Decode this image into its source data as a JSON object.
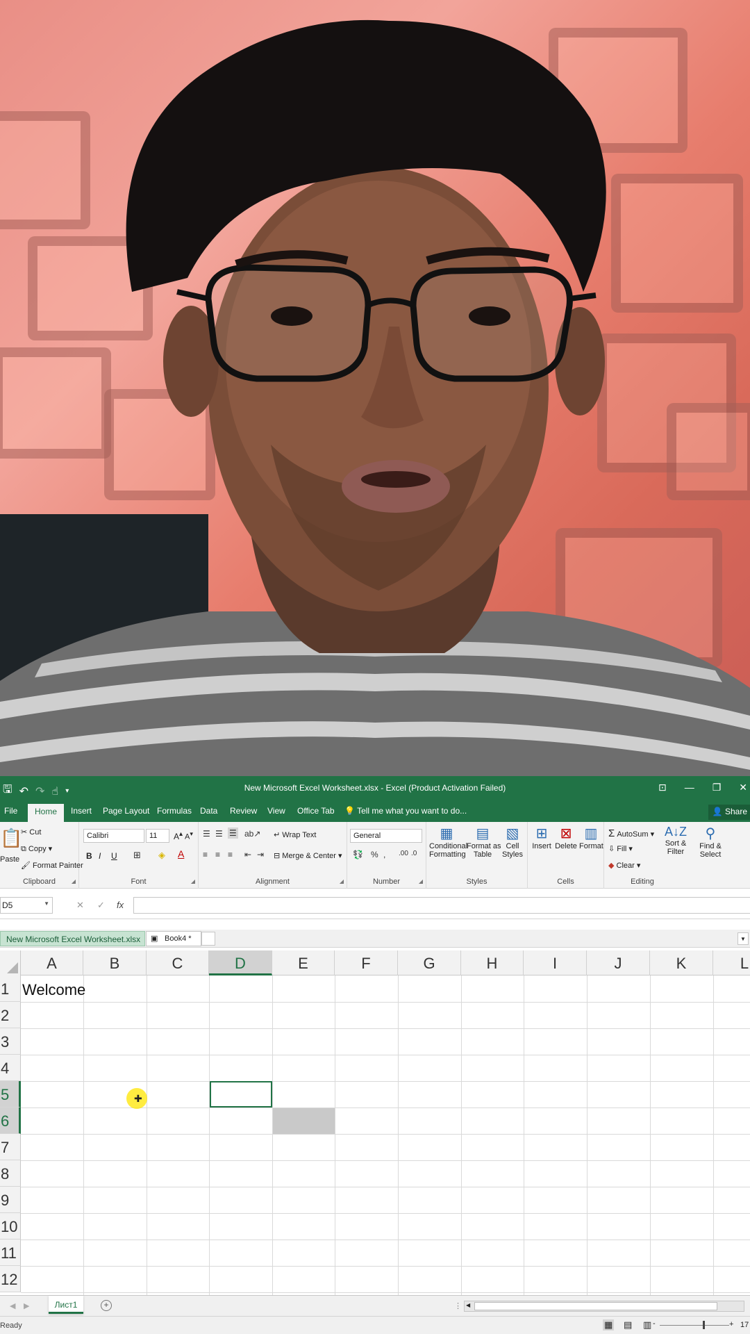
{
  "titlebar": {
    "title": "New Microsoft Excel Worksheet.xlsx - Excel (Product Activation Failed)"
  },
  "ribbon_tabs": [
    "File",
    "Home",
    "Insert",
    "Page Layout",
    "Formulas",
    "Data",
    "Review",
    "View",
    "Office Tab"
  ],
  "tell_me": "Tell me what you want to do...",
  "share_label": "Share",
  "clipboard": {
    "paste": "Paste",
    "cut": "Cut",
    "copy": "Copy",
    "format_painter": "Format Painter",
    "label": "Clipboard"
  },
  "font": {
    "name": "Calibri",
    "size": "11",
    "bold": "B",
    "italic": "I",
    "underline": "U",
    "label": "Font"
  },
  "alignment": {
    "wrap_text": "Wrap Text",
    "merge_center": "Merge & Center",
    "label": "Alignment"
  },
  "number": {
    "format": "General",
    "label": "Number"
  },
  "styles": {
    "conditional_1": "Conditional",
    "conditional_2": "Formatting",
    "format_table_1": "Format as",
    "format_table_2": "Table",
    "cell_styles_1": "Cell",
    "cell_styles_2": "Styles",
    "label": "Styles"
  },
  "cells": {
    "insert": "Insert",
    "delete": "Delete",
    "format": "Format",
    "label": "Cells"
  },
  "editing": {
    "autosum": "AutoSum",
    "fill": "Fill",
    "clear": "Clear",
    "sort_1": "Sort &",
    "sort_2": "Filter",
    "find_1": "Find &",
    "find_2": "Select",
    "label": "Editing"
  },
  "formula_bar": {
    "name_box": "D5",
    "fx": "fx",
    "cancel": "✕",
    "enter": "✓",
    "value": ""
  },
  "workbook_tabs": {
    "active": "New Microsoft Excel Worksheet.xlsx",
    "other": "Book4 *"
  },
  "columns": [
    "A",
    "B",
    "C",
    "D",
    "E",
    "F",
    "G",
    "H",
    "I",
    "J",
    "K",
    "L"
  ],
  "rows": [
    "1",
    "2",
    "3",
    "4",
    "5",
    "6",
    "7",
    "8",
    "9",
    "10",
    "11",
    "12"
  ],
  "cells_content": {
    "A1": "Welcome"
  },
  "selection": {
    "active_cell": "D5",
    "selected_column": "D",
    "selected_rows": [
      "5",
      "6"
    ]
  },
  "sheet_tab": "Лист1",
  "status": "Ready",
  "zoom_value": "17",
  "colors": {
    "excel_green": "#217346",
    "grid": "#d9d9d9",
    "cursor_highlight": "#ffe600"
  },
  "icons": [
    "save-icon",
    "undo-icon",
    "redo-icon",
    "touch-icon",
    "lightbulb-icon",
    "person-icon",
    "sigma-icon",
    "search-icon",
    "scissors-icon",
    "paint-bucket-icon",
    "plus-icon"
  ]
}
